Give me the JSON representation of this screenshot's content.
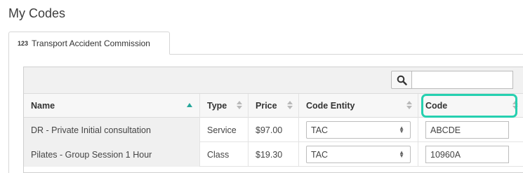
{
  "page": {
    "title": "My Codes"
  },
  "tabs": [
    {
      "icon": "123",
      "label": "Transport Accident Commission"
    }
  ],
  "colors": {
    "accent": "#26a69a",
    "highlight": "#26d0b0"
  },
  "table": {
    "columns": [
      "Name",
      "Type",
      "Price",
      "Code Entity",
      "Code"
    ],
    "rows": [
      {
        "name": "DR - Private Initial consultation",
        "type": "Service",
        "price": "$97.00",
        "code_entity": "TAC",
        "code": "ABCDE"
      },
      {
        "name": "Pilates - Group Session 1 Hour",
        "type": "Class",
        "price": "$19.30",
        "code_entity": "TAC",
        "code": "10960A"
      }
    ]
  }
}
